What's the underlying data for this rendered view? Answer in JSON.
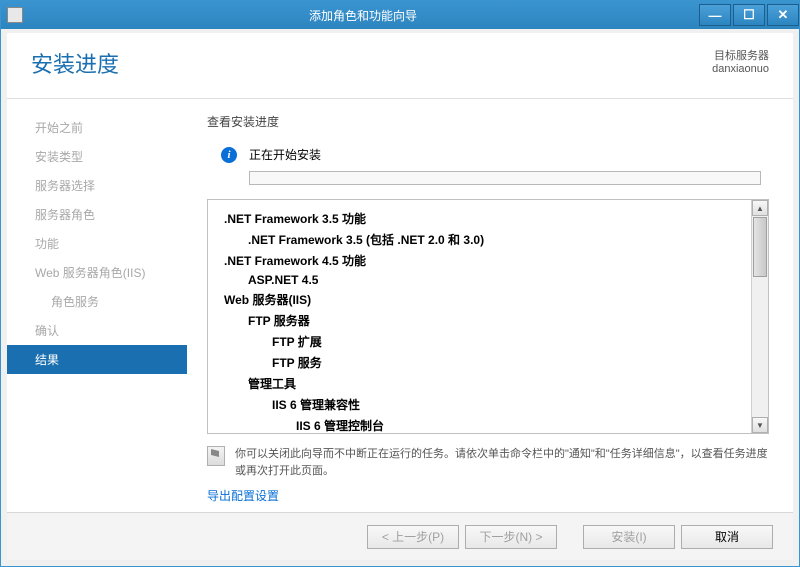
{
  "window": {
    "title": "添加角色和功能向导"
  },
  "header": {
    "heading": "安装进度",
    "target_label": "目标服务器",
    "target_name": "danxiaonuo"
  },
  "nav": {
    "items": [
      {
        "label": "开始之前",
        "active": false,
        "sub": false
      },
      {
        "label": "安装类型",
        "active": false,
        "sub": false
      },
      {
        "label": "服务器选择",
        "active": false,
        "sub": false
      },
      {
        "label": "服务器角色",
        "active": false,
        "sub": false
      },
      {
        "label": "功能",
        "active": false,
        "sub": false
      },
      {
        "label": "Web 服务器角色(IIS)",
        "active": false,
        "sub": false
      },
      {
        "label": "角色服务",
        "active": false,
        "sub": true
      },
      {
        "label": "确认",
        "active": false,
        "sub": false
      },
      {
        "label": "结果",
        "active": true,
        "sub": false
      }
    ]
  },
  "content": {
    "view_label": "查看安装进度",
    "status_text": "正在开始安装",
    "features": [
      {
        "text": ".NET Framework 3.5 功能",
        "lvl": 0
      },
      {
        "text": ".NET Framework 3.5 (包括 .NET 2.0 和 3.0)",
        "lvl": 1
      },
      {
        "text": ".NET Framework 4.5 功能",
        "lvl": 0
      },
      {
        "text": "ASP.NET 4.5",
        "lvl": 1
      },
      {
        "text": "Web 服务器(IIS)",
        "lvl": 0
      },
      {
        "text": "FTP 服务器",
        "lvl": 1
      },
      {
        "text": "FTP 扩展",
        "lvl": 2
      },
      {
        "text": "FTP 服务",
        "lvl": 2
      },
      {
        "text": "管理工具",
        "lvl": 1
      },
      {
        "text": "IIS 6 管理兼容性",
        "lvl": 2
      },
      {
        "text": "IIS 6 管理控制台",
        "lvl": 3
      }
    ],
    "note_text": "你可以关闭此向导而不中断正在运行的任务。请依次单击命令栏中的\"通知\"和\"任务详细信息\"，以查看任务进度或再次打开此页面。",
    "export_link": "导出配置设置"
  },
  "footer": {
    "prev": "< 上一步(P)",
    "next": "下一步(N) >",
    "install": "安装(I)",
    "cancel": "取消"
  }
}
